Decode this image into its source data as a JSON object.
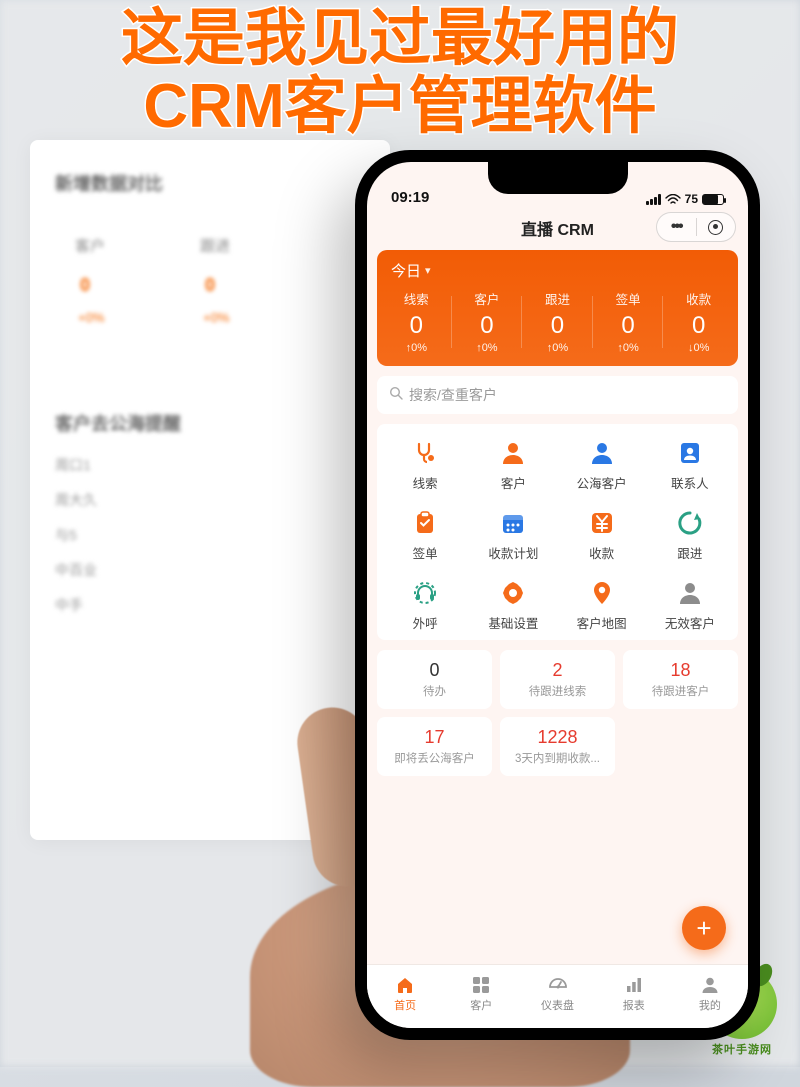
{
  "headline": "这是我见过最好用的\nCRM客户管理软件",
  "watermark_text": "茶叶手游网",
  "background": {
    "section1_title": "新增数据对比",
    "col1": "客户",
    "col2": "跟进",
    "val1": "0",
    "val2": "0",
    "pct1": "+0%",
    "pct2": "+0%",
    "section2_title": "客户去公海提醒",
    "rows": [
      "周口1",
      "周大久",
      "与5",
      "中百业",
      "中手"
    ]
  },
  "statusbar": {
    "time": "09:19",
    "battery": "75"
  },
  "app_title": "直播 CRM",
  "today": {
    "title": "今日",
    "metrics": [
      {
        "label": "线索",
        "value": "0",
        "delta": "↑0%"
      },
      {
        "label": "客户",
        "value": "0",
        "delta": "↑0%"
      },
      {
        "label": "跟进",
        "value": "0",
        "delta": "↑0%"
      },
      {
        "label": "签单",
        "value": "0",
        "delta": "↑0%"
      },
      {
        "label": "收款",
        "value": "0",
        "delta": "↓0%"
      }
    ]
  },
  "search_placeholder": "搜索/查重客户",
  "menu": [
    {
      "label": "线索",
      "color": "#f56b1a",
      "glyph": "stethoscope"
    },
    {
      "label": "客户",
      "color": "#f56b1a",
      "glyph": "person"
    },
    {
      "label": "公海客户",
      "color": "#2a78e4",
      "glyph": "person"
    },
    {
      "label": "联系人",
      "color": "#2a78e4",
      "glyph": "contact"
    },
    {
      "label": "签单",
      "color": "#f56b1a",
      "glyph": "clipboard"
    },
    {
      "label": "收款计划",
      "color": "#2a78e4",
      "glyph": "calendar"
    },
    {
      "label": "收款",
      "color": "#f56b1a",
      "glyph": "yen"
    },
    {
      "label": "跟进",
      "color": "#2aa084",
      "glyph": "swirl"
    },
    {
      "label": "外呼",
      "color": "#2aa084",
      "glyph": "headset"
    },
    {
      "label": "基础设置",
      "color": "#f56b1a",
      "glyph": "gear"
    },
    {
      "label": "客户地图",
      "color": "#f56b1a",
      "glyph": "pin"
    },
    {
      "label": "无效客户",
      "color": "#8c8c8c",
      "glyph": "person"
    }
  ],
  "stats": [
    {
      "num": "0",
      "red": false,
      "label": "待办"
    },
    {
      "num": "2",
      "red": true,
      "label": "待跟进线索"
    },
    {
      "num": "18",
      "red": true,
      "label": "待跟进客户"
    },
    {
      "num": "17",
      "red": true,
      "label": "即将丢公海客户"
    },
    {
      "num": "1228",
      "red": true,
      "label": "3天内到期收款..."
    }
  ],
  "fab": "+",
  "tabs": [
    {
      "label": "首页",
      "icon": "home",
      "active": true
    },
    {
      "label": "客户",
      "icon": "grid",
      "active": false
    },
    {
      "label": "仪表盘",
      "icon": "dashboard",
      "active": false
    },
    {
      "label": "报表",
      "icon": "report",
      "active": false
    },
    {
      "label": "我的",
      "icon": "user",
      "active": false
    }
  ]
}
